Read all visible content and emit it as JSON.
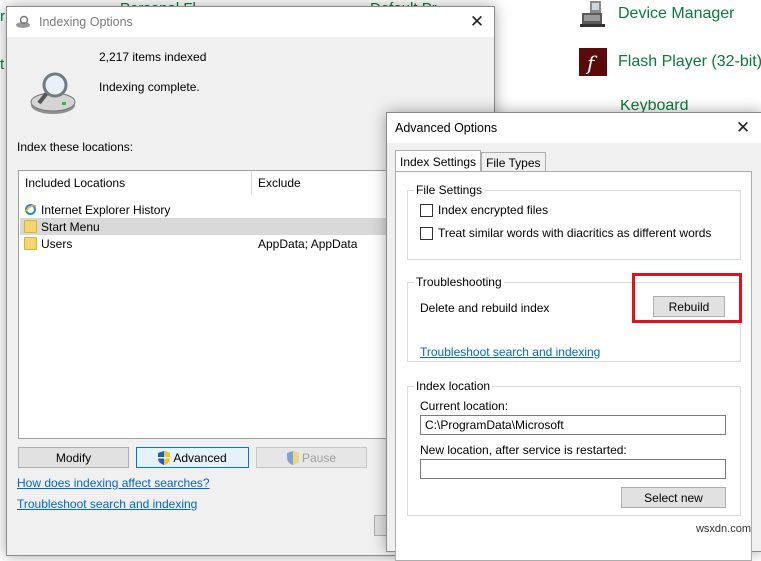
{
  "background": {
    "items": [
      {
        "label": "Device Manager",
        "icon": "device-manager-icon"
      },
      {
        "label": "Flash Player (32-bit)",
        "icon": "flash-player-icon"
      },
      {
        "label": "Keyboard",
        "icon": "keyboard-icon"
      }
    ],
    "partial_label": "Personal Fl",
    "partial_label2": "Default Pr",
    "watermark": "wsxdn.com",
    "brand_color": "#0b7a3a"
  },
  "indexing": {
    "title": "Indexing Options",
    "items_indexed": "2,217 items indexed",
    "status": "Indexing complete.",
    "locations_header": "Index these locations:",
    "columns": [
      "Included Locations",
      "Exclude"
    ],
    "rows": [
      {
        "location": "Internet Explorer History",
        "exclude": "",
        "icon": "ie-icon",
        "selected": false
      },
      {
        "location": "Start Menu",
        "exclude": "",
        "icon": "folder-icon",
        "selected": true
      },
      {
        "location": "Users",
        "exclude": "AppData; AppData",
        "icon": "folder-icon",
        "selected": false
      }
    ],
    "buttons": {
      "modify": "Modify",
      "advanced": "Advanced",
      "pause": "Pause"
    },
    "links": {
      "how": "How does indexing affect searches?",
      "troubleshoot": "Troubleshoot search and indexing"
    }
  },
  "advanced": {
    "title": "Advanced Options",
    "tabs": [
      "Index Settings",
      "File Types"
    ],
    "file_settings": {
      "title": "File Settings",
      "encrypt": "Index encrypted files",
      "diacritics": "Treat similar words with diacritics as different words"
    },
    "troubleshooting": {
      "title": "Troubleshooting",
      "rebuild_label": "Delete and rebuild index",
      "rebuild_button": "Rebuild",
      "link": "Troubleshoot search and indexing"
    },
    "index_location": {
      "title": "Index location",
      "current_label": "Current location:",
      "current_value": "C:\\ProgramData\\Microsoft",
      "new_label": "New location, after service is restarted:",
      "new_value": "",
      "select_button": "Select new"
    },
    "highlight_color": "#e01020"
  }
}
